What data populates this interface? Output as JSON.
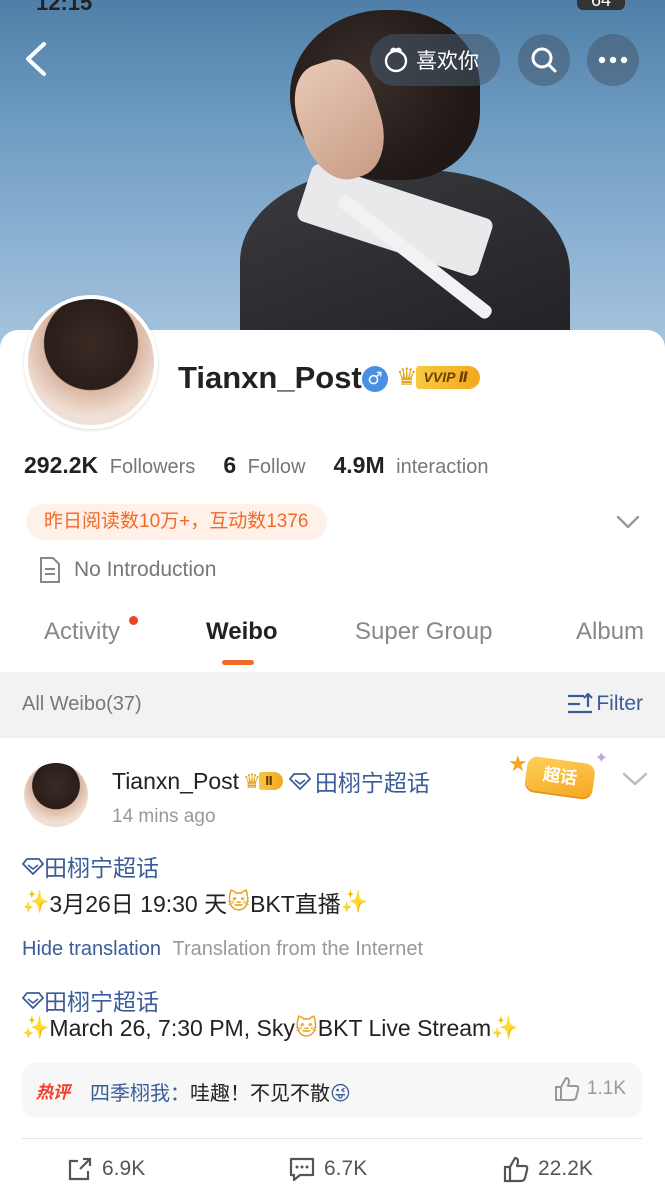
{
  "status_bar": {
    "time": "12:15",
    "battery": "64"
  },
  "header": {
    "like_label": "喜欢你"
  },
  "profile": {
    "username": "Tianxn_Post",
    "gender_symbol": "♂",
    "vip_label": "VVIP Ⅱ",
    "stats": [
      {
        "value": "292.2K",
        "label": "Followers"
      },
      {
        "value": "6",
        "label": "Follow"
      },
      {
        "value": "4.9M",
        "label": "interaction"
      }
    ],
    "reads_notice": "昨日阅读数10万+，互动数1376",
    "intro": "No Introduction"
  },
  "tabs": [
    {
      "label": "Activity",
      "has_dot": true
    },
    {
      "label": "Weibo",
      "active": true
    },
    {
      "label": "Super Group"
    },
    {
      "label": "Album"
    }
  ],
  "filter_bar": {
    "count_label": "All Weibo(37)",
    "filter_label": "Filter"
  },
  "post": {
    "user": "Tianxn_Post",
    "vip_level": "Ⅱ",
    "topic": "田栩宁超话",
    "time": "14 mins ago",
    "sticker_label": "超话",
    "content_topic": "田栩宁超话",
    "content_part1": "3月26日 19:30  天",
    "content_part2": "BKT直播",
    "translate_link": "Hide translation",
    "translate_note": "Translation from the Internet",
    "translated_topic": "田栩宁超话",
    "translated_part1": "March 26, 7:30 PM, Sky",
    "translated_part2": "BKT Live Stream",
    "hot_comment": {
      "tag": "热评",
      "author": "四季栩我：",
      "text": "哇趣！不见不散",
      "likes": "1.1K"
    },
    "actions": {
      "reposts": "6.9K",
      "comments": "6.7K",
      "likes": "22.2K"
    }
  },
  "colors": {
    "accent_orange": "#f06b2a",
    "link_blue": "#3a5d99",
    "vip_gold": "#f3a81d",
    "red_dot": "#f0402a"
  }
}
